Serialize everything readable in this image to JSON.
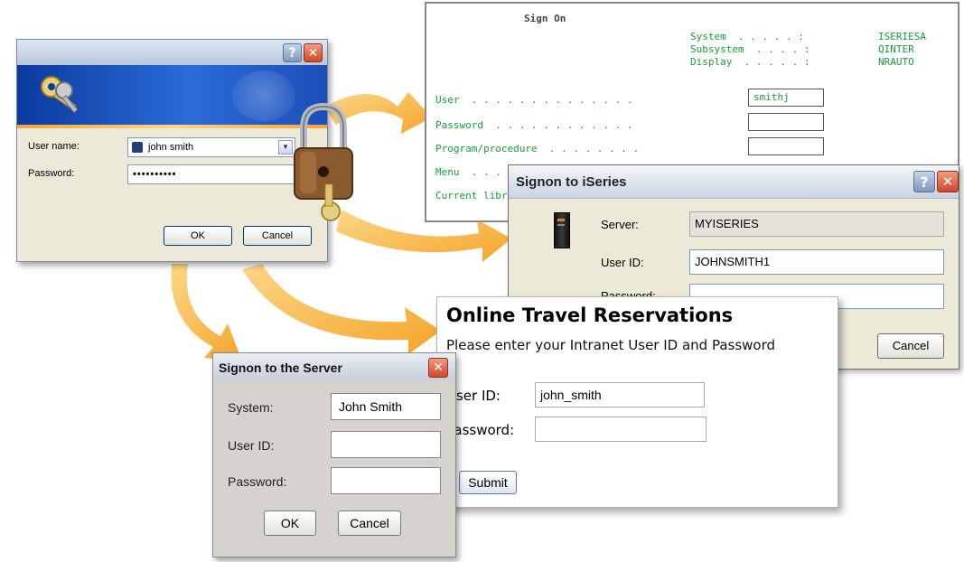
{
  "colors": {
    "arrow": "#f4a11a",
    "terminal_text": "#1a9c3a",
    "xp_title": "#c9d6ea"
  },
  "windows_login": {
    "help_glyph": "?",
    "close_glyph": "✕",
    "user_label": "User name:",
    "user_value": "john smith",
    "password_label": "Password:",
    "password_value": "••••••••••",
    "ok_label": "OK",
    "cancel_label": "Cancel"
  },
  "terminal": {
    "title": "Sign On",
    "system_label": "System  . . . . . :",
    "system_value": "ISERIESA",
    "subsystem_label": "Subsystem  . . . . :",
    "subsystem_value": "QINTER",
    "display_label": "Display  . . . . . :",
    "display_value": "NRAUTO",
    "user_label": "User  . . . . . . . . . . . . . .",
    "user_value": "smithj",
    "password_label": "Password  . . . . . . . . . . . .",
    "program_label": "Program/procedure  . . . . . . . .",
    "menu_label": "Menu  . . .",
    "library_label": "Current libr"
  },
  "iseries_dialog": {
    "title": "Signon to iSeries",
    "help_glyph": "?",
    "close_glyph": "✕",
    "server_label": "Server:",
    "server_value": "MYISERIES",
    "userid_label": "User ID:",
    "userid_value": "JOHNSMITH1",
    "password_label": "Password:",
    "cancel_label": "Cancel"
  },
  "web_form": {
    "title": "Online Travel Reservations",
    "instruction": "Please enter your Intranet User ID and Password",
    "userid_label": "User ID:",
    "userid_value": "john_smith",
    "password_label": "Password:",
    "password_value": "",
    "submit_label": "Submit"
  },
  "server_dialog": {
    "title": "Signon to the Server",
    "close_glyph": "✕",
    "system_label": "System:",
    "system_value": "John Smith",
    "userid_label": "User ID:",
    "userid_value": "",
    "password_label": "Password:",
    "password_value": "",
    "ok_label": "OK",
    "cancel_label": "Cancel"
  }
}
